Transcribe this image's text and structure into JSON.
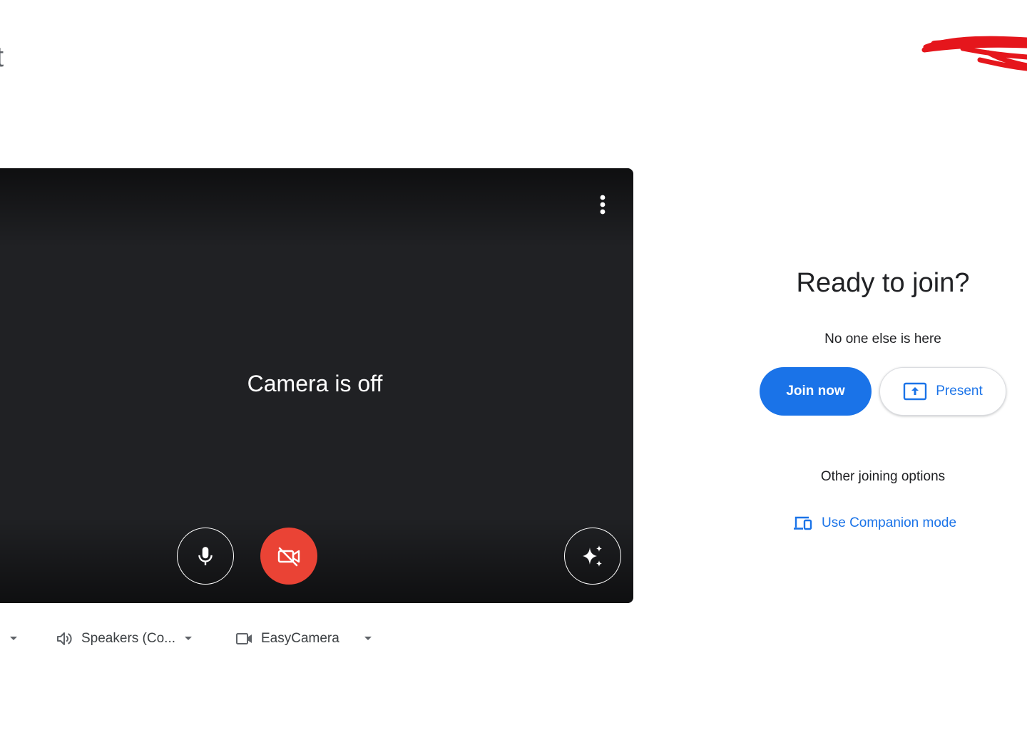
{
  "header": {
    "title_fragment": "t"
  },
  "preview": {
    "camera_status": "Camera is off",
    "controls": {
      "more_icon": "more-vert-icon",
      "mic_icon": "mic-icon",
      "camera_icon": "videocam-off-icon",
      "effects_icon": "sparkle-icon"
    }
  },
  "devices": {
    "microphone": {
      "label": ".",
      "icon": "mic-icon"
    },
    "speaker": {
      "label": "Speakers (Co...",
      "icon": "volume-icon"
    },
    "camera": {
      "label": "EasyCamera",
      "icon": "videocam-icon"
    }
  },
  "panel": {
    "title": "Ready to join?",
    "subtitle": "No one else is here",
    "join_label": "Join now",
    "present_label": "Present",
    "other_options_label": "Other joining options",
    "companion_label": "Use Companion mode"
  },
  "colors": {
    "primary": "#1a73e8",
    "danger": "#ea4335",
    "preview_bg": "#202124",
    "scribble": "#e5161c"
  }
}
